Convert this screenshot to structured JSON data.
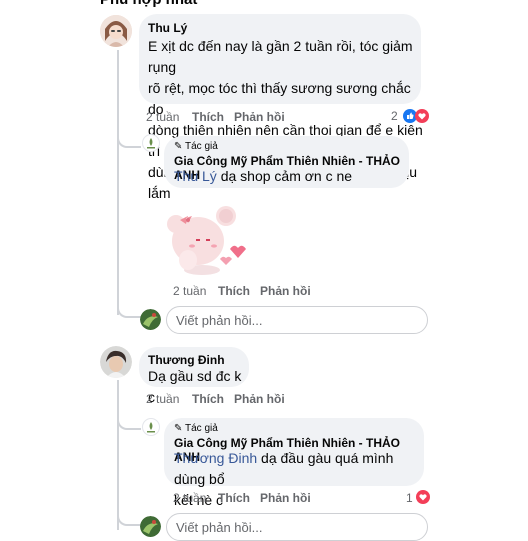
{
  "header": {
    "title": "Phù hợp nhất"
  },
  "comments": [
    {
      "author": "Thu Lý",
      "text_lines": [
        "E xịt dc đến nay là gần 2 tuần rồi, tóc giảm rụng",
        "rõ rệt, mọc tóc thì thấy sương sương chắc do",
        "dòng thiên nhiên nên cần thoi gian để e kiên trì",
        "dùng xem sao. Mùi bưởi thơm lừng dễ chịu lắm"
      ],
      "time": "2 tuần",
      "like": "Thích",
      "reply": "Phản hồi",
      "reaction_count": "2",
      "reply_item": {
        "badge": "Tác giả",
        "author": "Gia Công Mỹ Phẩm Thiên Nhiên - THẢO ANH",
        "mention": "Thu Lý",
        "text": " dạ shop cảm ơn c ne",
        "time": "2 tuần",
        "like": "Thích",
        "reply": "Phản hồi"
      },
      "reply_placeholder": "Viết phản hồi..."
    },
    {
      "author": "Thương Đinh",
      "text": "Dạ gầu sd đc k c",
      "time": "2 tuần",
      "like": "Thích",
      "reply": "Phản hồi",
      "reply_item": {
        "badge": "Tác giả",
        "author": "Gia Công Mỹ Phẩm Thiên Nhiên - THẢO ANH",
        "mention": "Thương Đinh",
        "text_line1": " dạ đầu gàu quá mình dùng bổ",
        "text_line2": "kết nè c",
        "time": "2 tuần",
        "like": "Thích",
        "reply": "Phản hồi",
        "reaction_count": "1"
      },
      "reply_placeholder": "Viết phản hồi..."
    }
  ],
  "colors": {
    "like_blue": "#1877f2",
    "love_red": "#f33e58",
    "mention": "#385898",
    "bubble": "#f0f2f5"
  },
  "icons": [
    "pencil-icon",
    "like-reaction-icon",
    "love-reaction-icon",
    "sticker-bunny"
  ]
}
